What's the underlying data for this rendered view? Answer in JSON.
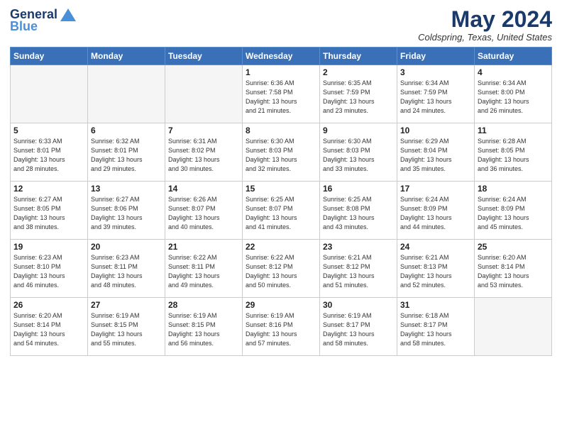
{
  "header": {
    "logo_general": "General",
    "logo_blue": "Blue",
    "month_title": "May 2024",
    "location": "Coldspring, Texas, United States"
  },
  "weekdays": [
    "Sunday",
    "Monday",
    "Tuesday",
    "Wednesday",
    "Thursday",
    "Friday",
    "Saturday"
  ],
  "weeks": [
    [
      {
        "day": "",
        "info": ""
      },
      {
        "day": "",
        "info": ""
      },
      {
        "day": "",
        "info": ""
      },
      {
        "day": "1",
        "info": "Sunrise: 6:36 AM\nSunset: 7:58 PM\nDaylight: 13 hours\nand 21 minutes."
      },
      {
        "day": "2",
        "info": "Sunrise: 6:35 AM\nSunset: 7:59 PM\nDaylight: 13 hours\nand 23 minutes."
      },
      {
        "day": "3",
        "info": "Sunrise: 6:34 AM\nSunset: 7:59 PM\nDaylight: 13 hours\nand 24 minutes."
      },
      {
        "day": "4",
        "info": "Sunrise: 6:34 AM\nSunset: 8:00 PM\nDaylight: 13 hours\nand 26 minutes."
      }
    ],
    [
      {
        "day": "5",
        "info": "Sunrise: 6:33 AM\nSunset: 8:01 PM\nDaylight: 13 hours\nand 28 minutes."
      },
      {
        "day": "6",
        "info": "Sunrise: 6:32 AM\nSunset: 8:01 PM\nDaylight: 13 hours\nand 29 minutes."
      },
      {
        "day": "7",
        "info": "Sunrise: 6:31 AM\nSunset: 8:02 PM\nDaylight: 13 hours\nand 30 minutes."
      },
      {
        "day": "8",
        "info": "Sunrise: 6:30 AM\nSunset: 8:03 PM\nDaylight: 13 hours\nand 32 minutes."
      },
      {
        "day": "9",
        "info": "Sunrise: 6:30 AM\nSunset: 8:03 PM\nDaylight: 13 hours\nand 33 minutes."
      },
      {
        "day": "10",
        "info": "Sunrise: 6:29 AM\nSunset: 8:04 PM\nDaylight: 13 hours\nand 35 minutes."
      },
      {
        "day": "11",
        "info": "Sunrise: 6:28 AM\nSunset: 8:05 PM\nDaylight: 13 hours\nand 36 minutes."
      }
    ],
    [
      {
        "day": "12",
        "info": "Sunrise: 6:27 AM\nSunset: 8:05 PM\nDaylight: 13 hours\nand 38 minutes."
      },
      {
        "day": "13",
        "info": "Sunrise: 6:27 AM\nSunset: 8:06 PM\nDaylight: 13 hours\nand 39 minutes."
      },
      {
        "day": "14",
        "info": "Sunrise: 6:26 AM\nSunset: 8:07 PM\nDaylight: 13 hours\nand 40 minutes."
      },
      {
        "day": "15",
        "info": "Sunrise: 6:25 AM\nSunset: 8:07 PM\nDaylight: 13 hours\nand 41 minutes."
      },
      {
        "day": "16",
        "info": "Sunrise: 6:25 AM\nSunset: 8:08 PM\nDaylight: 13 hours\nand 43 minutes."
      },
      {
        "day": "17",
        "info": "Sunrise: 6:24 AM\nSunset: 8:09 PM\nDaylight: 13 hours\nand 44 minutes."
      },
      {
        "day": "18",
        "info": "Sunrise: 6:24 AM\nSunset: 8:09 PM\nDaylight: 13 hours\nand 45 minutes."
      }
    ],
    [
      {
        "day": "19",
        "info": "Sunrise: 6:23 AM\nSunset: 8:10 PM\nDaylight: 13 hours\nand 46 minutes."
      },
      {
        "day": "20",
        "info": "Sunrise: 6:23 AM\nSunset: 8:11 PM\nDaylight: 13 hours\nand 48 minutes."
      },
      {
        "day": "21",
        "info": "Sunrise: 6:22 AM\nSunset: 8:11 PM\nDaylight: 13 hours\nand 49 minutes."
      },
      {
        "day": "22",
        "info": "Sunrise: 6:22 AM\nSunset: 8:12 PM\nDaylight: 13 hours\nand 50 minutes."
      },
      {
        "day": "23",
        "info": "Sunrise: 6:21 AM\nSunset: 8:12 PM\nDaylight: 13 hours\nand 51 minutes."
      },
      {
        "day": "24",
        "info": "Sunrise: 6:21 AM\nSunset: 8:13 PM\nDaylight: 13 hours\nand 52 minutes."
      },
      {
        "day": "25",
        "info": "Sunrise: 6:20 AM\nSunset: 8:14 PM\nDaylight: 13 hours\nand 53 minutes."
      }
    ],
    [
      {
        "day": "26",
        "info": "Sunrise: 6:20 AM\nSunset: 8:14 PM\nDaylight: 13 hours\nand 54 minutes."
      },
      {
        "day": "27",
        "info": "Sunrise: 6:19 AM\nSunset: 8:15 PM\nDaylight: 13 hours\nand 55 minutes."
      },
      {
        "day": "28",
        "info": "Sunrise: 6:19 AM\nSunset: 8:15 PM\nDaylight: 13 hours\nand 56 minutes."
      },
      {
        "day": "29",
        "info": "Sunrise: 6:19 AM\nSunset: 8:16 PM\nDaylight: 13 hours\nand 57 minutes."
      },
      {
        "day": "30",
        "info": "Sunrise: 6:19 AM\nSunset: 8:17 PM\nDaylight: 13 hours\nand 58 minutes."
      },
      {
        "day": "31",
        "info": "Sunrise: 6:18 AM\nSunset: 8:17 PM\nDaylight: 13 hours\nand 58 minutes."
      },
      {
        "day": "",
        "info": ""
      }
    ]
  ]
}
